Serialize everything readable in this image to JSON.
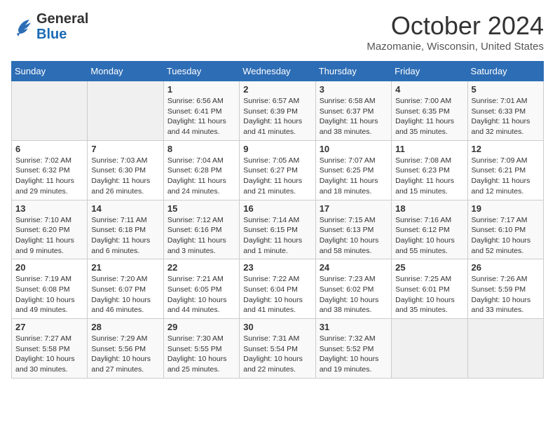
{
  "header": {
    "logo_line1": "General",
    "logo_line2": "Blue",
    "month": "October 2024",
    "location": "Mazomanie, Wisconsin, United States"
  },
  "weekdays": [
    "Sunday",
    "Monday",
    "Tuesday",
    "Wednesday",
    "Thursday",
    "Friday",
    "Saturday"
  ],
  "weeks": [
    [
      {
        "day": "",
        "info": ""
      },
      {
        "day": "",
        "info": ""
      },
      {
        "day": "1",
        "info": "Sunrise: 6:56 AM\nSunset: 6:41 PM\nDaylight: 11 hours and 44 minutes."
      },
      {
        "day": "2",
        "info": "Sunrise: 6:57 AM\nSunset: 6:39 PM\nDaylight: 11 hours and 41 minutes."
      },
      {
        "day": "3",
        "info": "Sunrise: 6:58 AM\nSunset: 6:37 PM\nDaylight: 11 hours and 38 minutes."
      },
      {
        "day": "4",
        "info": "Sunrise: 7:00 AM\nSunset: 6:35 PM\nDaylight: 11 hours and 35 minutes."
      },
      {
        "day": "5",
        "info": "Sunrise: 7:01 AM\nSunset: 6:33 PM\nDaylight: 11 hours and 32 minutes."
      }
    ],
    [
      {
        "day": "6",
        "info": "Sunrise: 7:02 AM\nSunset: 6:32 PM\nDaylight: 11 hours and 29 minutes."
      },
      {
        "day": "7",
        "info": "Sunrise: 7:03 AM\nSunset: 6:30 PM\nDaylight: 11 hours and 26 minutes."
      },
      {
        "day": "8",
        "info": "Sunrise: 7:04 AM\nSunset: 6:28 PM\nDaylight: 11 hours and 24 minutes."
      },
      {
        "day": "9",
        "info": "Sunrise: 7:05 AM\nSunset: 6:27 PM\nDaylight: 11 hours and 21 minutes."
      },
      {
        "day": "10",
        "info": "Sunrise: 7:07 AM\nSunset: 6:25 PM\nDaylight: 11 hours and 18 minutes."
      },
      {
        "day": "11",
        "info": "Sunrise: 7:08 AM\nSunset: 6:23 PM\nDaylight: 11 hours and 15 minutes."
      },
      {
        "day": "12",
        "info": "Sunrise: 7:09 AM\nSunset: 6:21 PM\nDaylight: 11 hours and 12 minutes."
      }
    ],
    [
      {
        "day": "13",
        "info": "Sunrise: 7:10 AM\nSunset: 6:20 PM\nDaylight: 11 hours and 9 minutes."
      },
      {
        "day": "14",
        "info": "Sunrise: 7:11 AM\nSunset: 6:18 PM\nDaylight: 11 hours and 6 minutes."
      },
      {
        "day": "15",
        "info": "Sunrise: 7:12 AM\nSunset: 6:16 PM\nDaylight: 11 hours and 3 minutes."
      },
      {
        "day": "16",
        "info": "Sunrise: 7:14 AM\nSunset: 6:15 PM\nDaylight: 11 hours and 1 minute."
      },
      {
        "day": "17",
        "info": "Sunrise: 7:15 AM\nSunset: 6:13 PM\nDaylight: 10 hours and 58 minutes."
      },
      {
        "day": "18",
        "info": "Sunrise: 7:16 AM\nSunset: 6:12 PM\nDaylight: 10 hours and 55 minutes."
      },
      {
        "day": "19",
        "info": "Sunrise: 7:17 AM\nSunset: 6:10 PM\nDaylight: 10 hours and 52 minutes."
      }
    ],
    [
      {
        "day": "20",
        "info": "Sunrise: 7:19 AM\nSunset: 6:08 PM\nDaylight: 10 hours and 49 minutes."
      },
      {
        "day": "21",
        "info": "Sunrise: 7:20 AM\nSunset: 6:07 PM\nDaylight: 10 hours and 46 minutes."
      },
      {
        "day": "22",
        "info": "Sunrise: 7:21 AM\nSunset: 6:05 PM\nDaylight: 10 hours and 44 minutes."
      },
      {
        "day": "23",
        "info": "Sunrise: 7:22 AM\nSunset: 6:04 PM\nDaylight: 10 hours and 41 minutes."
      },
      {
        "day": "24",
        "info": "Sunrise: 7:23 AM\nSunset: 6:02 PM\nDaylight: 10 hours and 38 minutes."
      },
      {
        "day": "25",
        "info": "Sunrise: 7:25 AM\nSunset: 6:01 PM\nDaylight: 10 hours and 35 minutes."
      },
      {
        "day": "26",
        "info": "Sunrise: 7:26 AM\nSunset: 5:59 PM\nDaylight: 10 hours and 33 minutes."
      }
    ],
    [
      {
        "day": "27",
        "info": "Sunrise: 7:27 AM\nSunset: 5:58 PM\nDaylight: 10 hours and 30 minutes."
      },
      {
        "day": "28",
        "info": "Sunrise: 7:29 AM\nSunset: 5:56 PM\nDaylight: 10 hours and 27 minutes."
      },
      {
        "day": "29",
        "info": "Sunrise: 7:30 AM\nSunset: 5:55 PM\nDaylight: 10 hours and 25 minutes."
      },
      {
        "day": "30",
        "info": "Sunrise: 7:31 AM\nSunset: 5:54 PM\nDaylight: 10 hours and 22 minutes."
      },
      {
        "day": "31",
        "info": "Sunrise: 7:32 AM\nSunset: 5:52 PM\nDaylight: 10 hours and 19 minutes."
      },
      {
        "day": "",
        "info": ""
      },
      {
        "day": "",
        "info": ""
      }
    ]
  ]
}
